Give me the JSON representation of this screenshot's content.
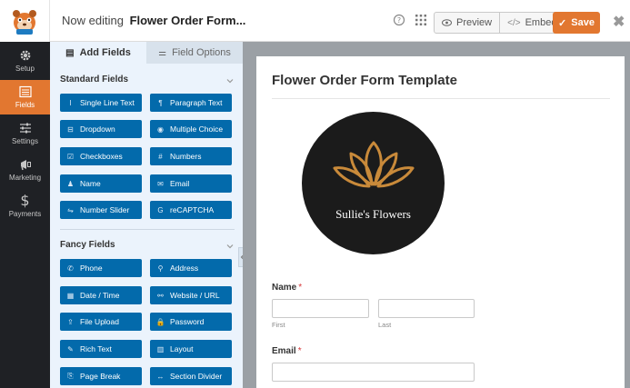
{
  "topbar": {
    "now_editing": "Now editing",
    "form_name": "Flower Order Form...",
    "preview": "Preview",
    "embed": "Embed",
    "save": "Save"
  },
  "nav": [
    {
      "label": "Setup",
      "icon": "gear-icon"
    },
    {
      "label": "Fields",
      "icon": "fields-icon"
    },
    {
      "label": "Settings",
      "icon": "sliders-icon"
    },
    {
      "label": "Marketing",
      "icon": "megaphone-icon"
    },
    {
      "label": "Payments",
      "icon": "dollar-icon"
    }
  ],
  "tabs": {
    "add_fields": "Add Fields",
    "field_options": "Field Options"
  },
  "standard": {
    "title": "Standard Fields",
    "items": [
      "Single Line Text",
      "Paragraph Text",
      "Dropdown",
      "Multiple Choice",
      "Checkboxes",
      "Numbers",
      "Name",
      "Email",
      "Number Slider",
      "reCAPTCHA"
    ],
    "icons": [
      "I",
      "¶",
      "⊟",
      "◉",
      "☑",
      "#",
      "♟",
      "✉",
      "⇋",
      "G"
    ]
  },
  "fancy": {
    "title": "Fancy Fields",
    "items": [
      "Phone",
      "Address",
      "Date / Time",
      "Website / URL",
      "File Upload",
      "Password",
      "Rich Text",
      "Layout",
      "Page Break",
      "Section Divider"
    ],
    "icons": [
      "✆",
      "⚲",
      "▦",
      "⚯",
      "⇪",
      "🔒",
      "✎",
      "▥",
      "⎘",
      "↔"
    ]
  },
  "form": {
    "title": "Flower Order Form Template",
    "brand": "Sullie's Flowers",
    "name_label": "Name",
    "required_mark": "*",
    "first": "First",
    "last": "Last",
    "email_label": "Email"
  },
  "colors": {
    "accent": "#e27730",
    "field_button": "#036aab",
    "nav_bg": "#1f2125",
    "logo_gold": "#c98a3a"
  }
}
